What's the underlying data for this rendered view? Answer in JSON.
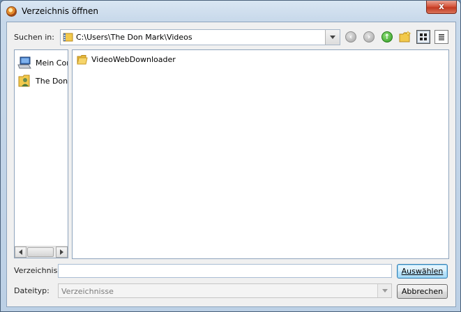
{
  "window": {
    "title": "Verzeichnis öffnen",
    "close_label": "x"
  },
  "toolbar": {
    "look_in_label": "Suchen in:",
    "path": "C:\\Users\\The Don Mark\\Videos",
    "back_icon": "back-arrow-icon",
    "forward_icon": "forward-arrow-icon",
    "up_icon": "up-folder-icon",
    "new_folder_icon": "new-folder-icon",
    "view_list_icon": "list-view-icon",
    "view_details_icon": "details-view-icon"
  },
  "places": {
    "items": [
      {
        "label": "Mein Computer",
        "icon": "computer-icon"
      },
      {
        "label": "The Don Mark",
        "icon": "user-folder-icon"
      }
    ]
  },
  "files": {
    "items": [
      {
        "label": "VideoWebDownloader",
        "icon": "folder-icon"
      }
    ]
  },
  "form": {
    "directory_label": "Verzeichnis:",
    "directory_value": "",
    "filetype_label": "Dateityp:",
    "filetype_value": "Verzeichnisse"
  },
  "buttons": {
    "select_label": "Auswählen",
    "cancel_label": "Abbrechen"
  },
  "colors": {
    "accent": "#3c7fb1",
    "close_red": "#c23a22",
    "up_green": "#2f9a20",
    "folder_yellow": "#f2c94c"
  }
}
